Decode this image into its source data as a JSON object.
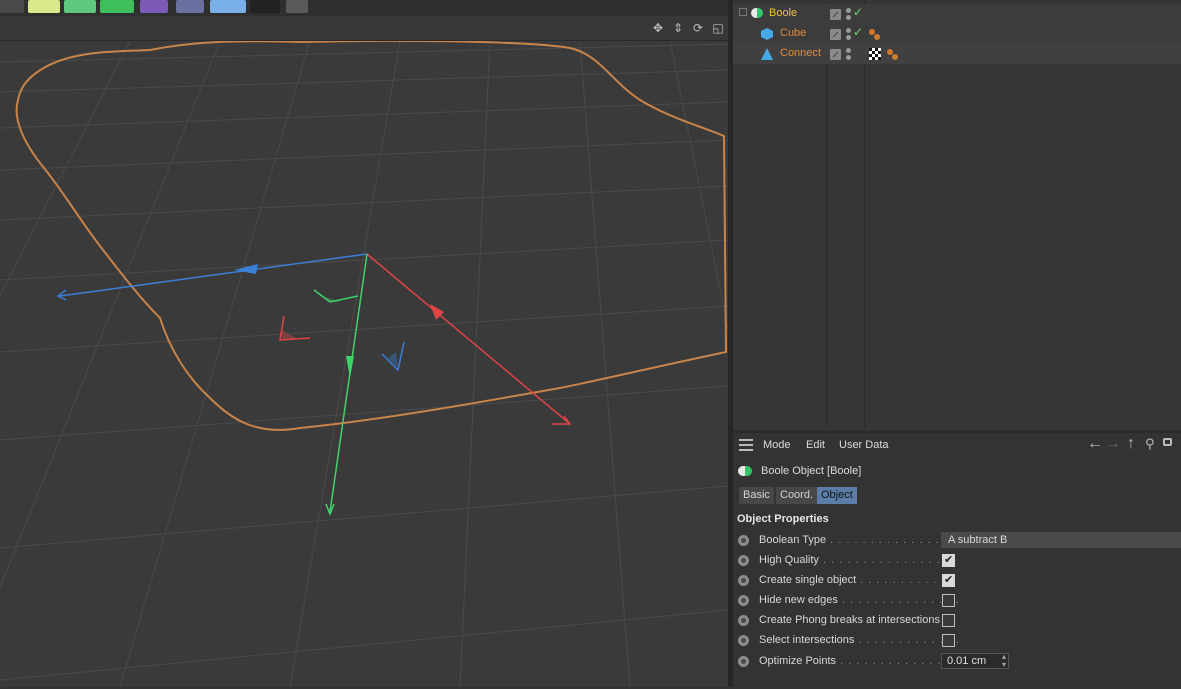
{
  "object_manager": {
    "objects": [
      {
        "name": "Boole",
        "color": "#f0c040"
      },
      {
        "name": "Cube",
        "color": "#e08a3c"
      },
      {
        "name": "Connect",
        "color": "#e08a3c"
      }
    ]
  },
  "attribute_manager": {
    "menu": [
      "Mode",
      "Edit",
      "User Data"
    ],
    "title": "Boole Object [Boole]",
    "tabs": [
      "Basic",
      "Coord.",
      "Object"
    ],
    "active_tab": "Object",
    "section": "Object Properties",
    "properties": {
      "boolean_type": {
        "label": "Boolean Type",
        "value": "A subtract B"
      },
      "high_quality": {
        "label": "High Quality",
        "checked": true
      },
      "create_single_object": {
        "label": "Create single object",
        "checked": true
      },
      "hide_new_edges": {
        "label": "Hide new edges",
        "checked": false
      },
      "phong_breaks": {
        "label": "Create Phong breaks at intersections",
        "checked": false
      },
      "select_intersections": {
        "label": "Select intersections",
        "checked": false
      },
      "optimize_points": {
        "label": "Optimize Points",
        "value": "0.01 cm"
      }
    }
  },
  "colors": {
    "axis_x": "#e04444",
    "axis_y": "#3fd36a",
    "axis_z": "#3a7fd8",
    "outline": "#c8844a",
    "active_tab": "#5b7ea8"
  }
}
